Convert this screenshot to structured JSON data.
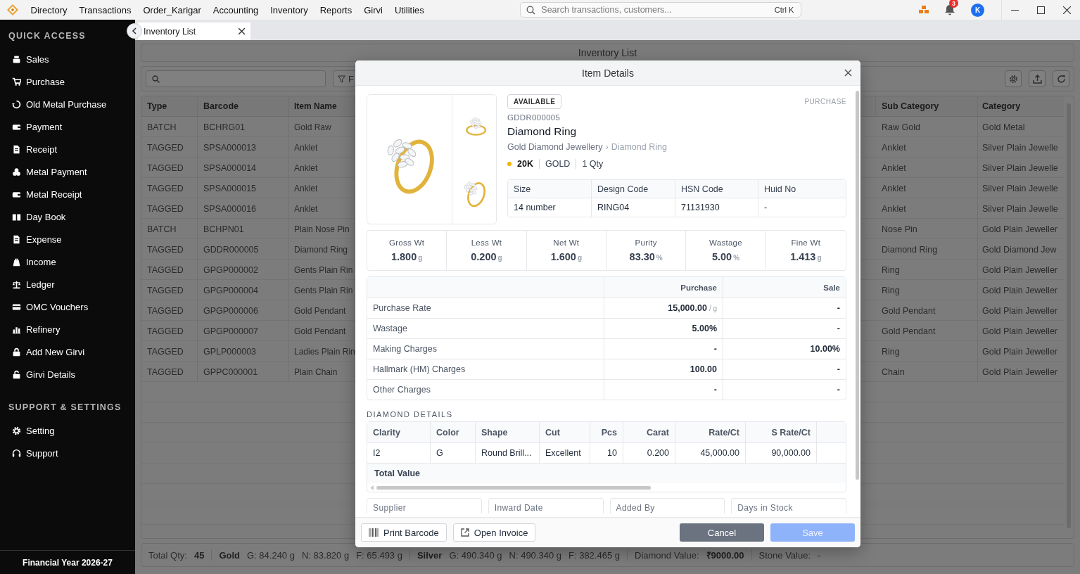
{
  "menu": {
    "items": [
      "Directory",
      "Transactions",
      "Order_Karigar",
      "Accounting",
      "Inventory",
      "Reports",
      "Girvi",
      "Utilities"
    ]
  },
  "search": {
    "placeholder": "Search transactions, customers...",
    "shortcut": "Ctrl K"
  },
  "notifications": {
    "count": "3"
  },
  "user": {
    "initial": "K"
  },
  "sidebar": {
    "sections": [
      {
        "title": "QUICK ACCESS",
        "items": [
          "Sales",
          "Purchase",
          "Old Metal Purchase",
          "Payment",
          "Receipt",
          "Metal Payment",
          "Metal Receipt",
          "Day Book",
          "Expense",
          "Income",
          "Ledger",
          "OMC Vouchers",
          "Refinery",
          "Add New Girvi",
          "Girvi Details"
        ]
      },
      {
        "title": "SUPPORT & SETTINGS",
        "items": [
          "Setting",
          "Support"
        ]
      }
    ],
    "footer": "Financial Year 2026-27"
  },
  "tabs": [
    {
      "label": "Inventory List",
      "selected": true
    }
  ],
  "page": {
    "title": "Inventory List",
    "filter_label": "F"
  },
  "table": {
    "columns": [
      "Type",
      "Barcode",
      "Item Name",
      "Sub Category",
      "Category"
    ],
    "rows": [
      [
        "BATCH",
        "BCHRG01",
        "Gold Raw",
        "Raw Gold",
        "Gold Metal"
      ],
      [
        "TAGGED",
        "SPSA000013",
        "Anklet",
        "Anklet",
        "Silver Plain Jewelle"
      ],
      [
        "TAGGED",
        "SPSA000014",
        "Anklet",
        "Anklet",
        "Silver Plain Jewelle"
      ],
      [
        "TAGGED",
        "SPSA000015",
        "Anklet",
        "Anklet",
        "Silver Plain Jewelle"
      ],
      [
        "TAGGED",
        "SPSA000016",
        "Anklet",
        "Anklet",
        "Silver Plain Jewelle"
      ],
      [
        "BATCH",
        "BCHPN01",
        "Plain Nose Pin",
        "Nose Pin",
        "Gold Plain Jeweller"
      ],
      [
        "TAGGED",
        "GDDR000005",
        "Diamond Ring",
        "Diamond Ring",
        "Gold Diamond Jew"
      ],
      [
        "TAGGED",
        "GPGP000002",
        "Gents Plain Rin",
        "Ring",
        "Gold Plain Jeweller"
      ],
      [
        "TAGGED",
        "GPGP000004",
        "Gents Plain Rin",
        "Ring",
        "Gold Plain Jeweller"
      ],
      [
        "TAGGED",
        "GPGP000006",
        "Gold Pendant",
        "Gold Pendant",
        "Gold Plain Jeweller"
      ],
      [
        "TAGGED",
        "GPGP000007",
        "Gold Pendant",
        "Gold Pendant",
        "Gold Plain Jeweller"
      ],
      [
        "TAGGED",
        "GPLP000003",
        "Ladies Plain Rin",
        "Ring",
        "Gold Plain Jeweller"
      ],
      [
        "TAGGED",
        "GPPC000001",
        "Plain Chain",
        "Chain",
        "Gold Plain Jeweller"
      ]
    ]
  },
  "status_bar": {
    "total_label": "Total Qty:",
    "total": "45",
    "groups": [
      {
        "name": "Gold",
        "values": [
          "G: 84.240 g",
          "N: 83.820 g",
          "F: 65.493 g"
        ]
      },
      {
        "name": "Silver",
        "values": [
          "G: 490.340 g",
          "N: 490.340 g",
          "F: 382.465 g"
        ]
      }
    ],
    "diamond_label": "Diamond Value:",
    "diamond_value": "₹9000.00",
    "stone_label": "Stone Value:",
    "stone_value": "-"
  },
  "modal": {
    "title": "Item Details",
    "status": "AVAILABLE",
    "source": "PURCHASE",
    "code": "GDDR000005",
    "name": "Diamond Ring",
    "breadcrumb": [
      "Gold Diamond Jewellery",
      "›",
      "Diamond Ring"
    ],
    "purity": {
      "label": "20K",
      "color": "#f5b301"
    },
    "metal": "GOLD",
    "qty": "1 Qty",
    "attributes": [
      {
        "label": "Size",
        "value": "14 number"
      },
      {
        "label": "Design Code",
        "value": "RING04"
      },
      {
        "label": "HSN Code",
        "value": "71131930"
      },
      {
        "label": "Huid No",
        "value": "-"
      }
    ],
    "weights": [
      {
        "label": "Gross Wt",
        "value": "1.800",
        "unit": "g"
      },
      {
        "label": "Less Wt",
        "value": "0.200",
        "unit": "g"
      },
      {
        "label": "Net Wt",
        "value": "1.600",
        "unit": "g"
      },
      {
        "label": "Purity",
        "value": "83.30",
        "unit": "%"
      },
      {
        "label": "Wastage",
        "value": "5.00",
        "unit": "%"
      },
      {
        "label": "Fine Wt",
        "value": "1.413",
        "unit": "g"
      }
    ],
    "pricing": {
      "columns": [
        "Purchase",
        "Sale"
      ],
      "rows": [
        {
          "label": "Purchase Rate",
          "purchase": "15,000.00",
          "unit": "/ g",
          "sale": "-"
        },
        {
          "label": "Wastage",
          "purchase": "5.00%",
          "sale": "-"
        },
        {
          "label": "Making Charges",
          "purchase": "-",
          "sale": "10.00%"
        },
        {
          "label": "Hallmark (HM) Charges",
          "purchase": "100.00",
          "sale": "-"
        },
        {
          "label": "Other Charges",
          "purchase": "-",
          "sale": "-"
        }
      ]
    },
    "diamonds": {
      "title": "DIAMOND DETAILS",
      "columns": [
        "Clarity",
        "Color",
        "Shape",
        "Cut",
        "Pcs",
        "Carat",
        "Rate/Ct",
        "S Rate/Ct"
      ],
      "rows": [
        [
          "I2",
          "G",
          "Round Brill...",
          "Excellent",
          "10",
          "0.200",
          "45,000.00",
          "90,000.00"
        ]
      ],
      "total_label": "Total Value"
    },
    "info_fields": [
      "Supplier",
      "Inward Date",
      "Added By",
      "Days in Stock"
    ],
    "buttons": [
      {
        "label": "Print Barcode",
        "kind": "barcode",
        "disabled": false
      },
      {
        "label": "Open Invoice",
        "kind": "invoice",
        "disabled": false
      },
      {
        "label": "Cancel",
        "kind": "cancel",
        "disabled": false
      },
      {
        "label": "Save",
        "kind": "save",
        "disabled": true
      }
    ]
  }
}
